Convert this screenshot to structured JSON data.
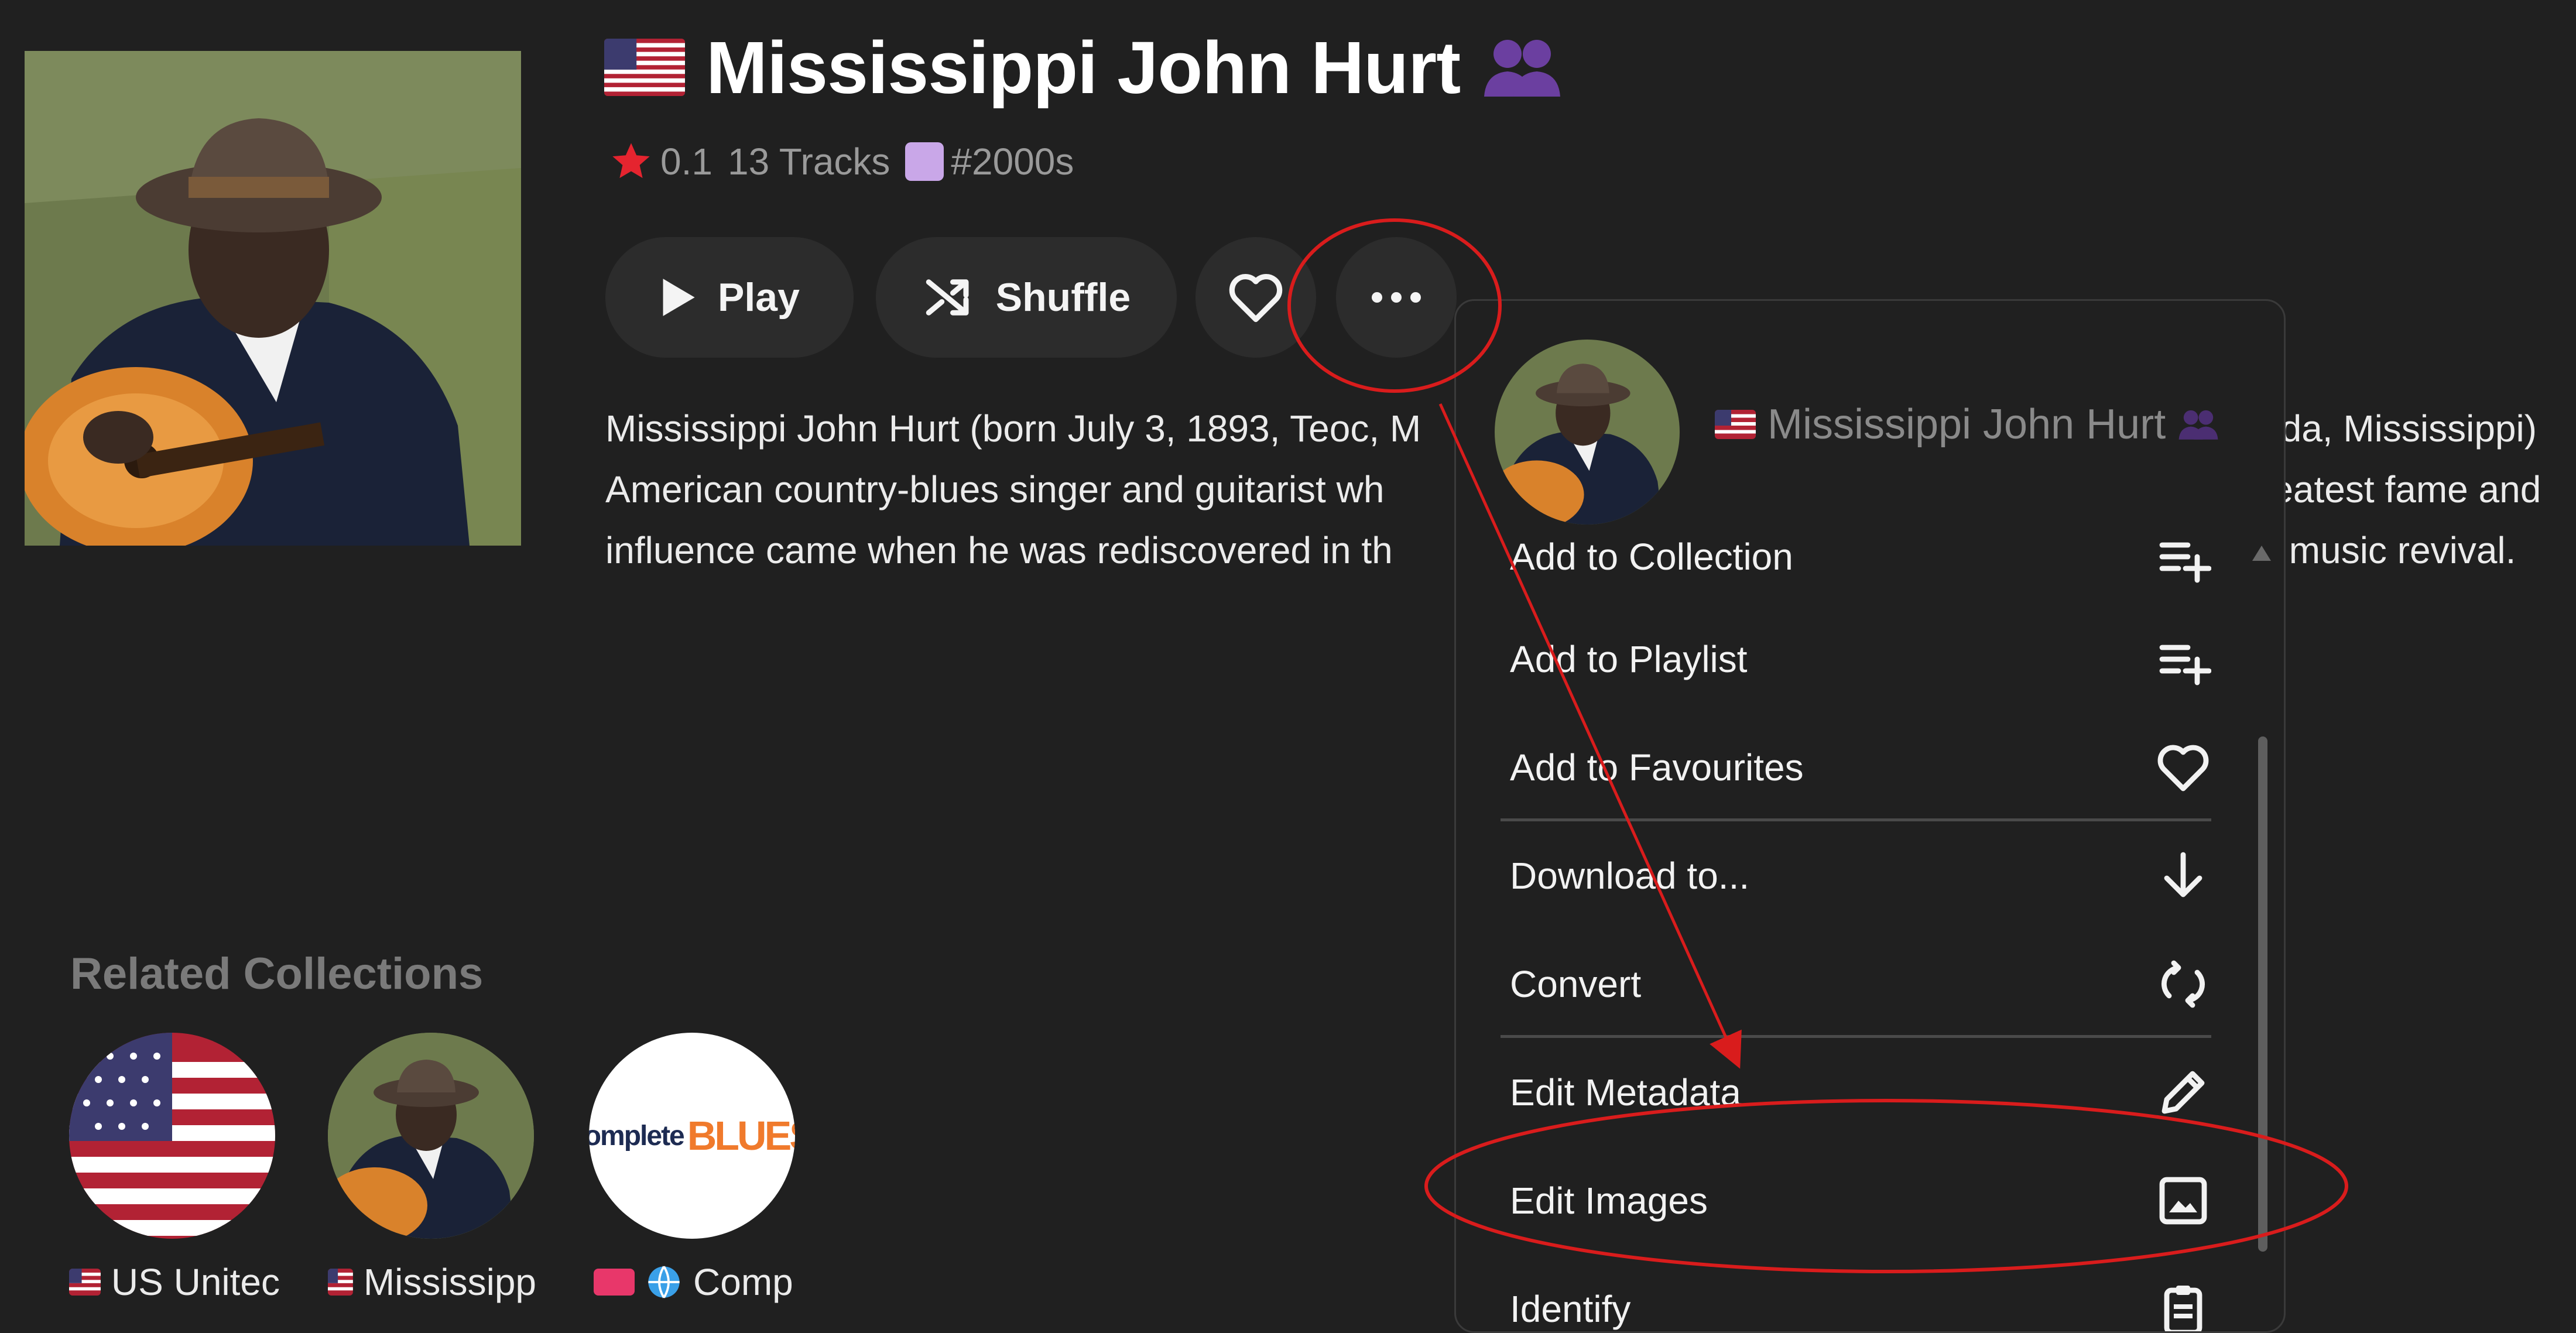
{
  "artist": {
    "name": "Mississippi John Hurt",
    "flag": "us-flag",
    "type_icon": "group-icon",
    "rating": "0.1",
    "tracks": "13 Tracks",
    "tag": "#2000s"
  },
  "actions": {
    "play": "Play",
    "shuffle": "Shuffle"
  },
  "bio": {
    "lines": [
      "Mississippi John Hurt (born July 3, 1893, Teoc, M",
      "American country-blues singer and guitarist wh",
      "influence came when he was rediscovered in th"
    ],
    "lines_right": [
      "ada, Mississippi)",
      "reatest fame and",
      "k music revival."
    ]
  },
  "related": {
    "heading": "Related Collections",
    "items": [
      {
        "label": "US Unitec",
        "thumb": "us-flag"
      },
      {
        "label": "Mississipp",
        "thumb": "artist-photo"
      },
      {
        "label": "Comp",
        "thumb": "complete-blues-logo",
        "logo_text": "complete",
        "logo_text2": "BLUES"
      }
    ]
  },
  "menu": {
    "header_name": "Mississippi John Hurt",
    "items": [
      {
        "label": "Add to Collection",
        "icon": "playlist-add-icon"
      },
      {
        "label": "Add to Playlist",
        "icon": "playlist-add-icon"
      },
      {
        "label": "Add to Favourites",
        "icon": "heart-icon"
      },
      {
        "label": "Download to...",
        "icon": "arrow-down-icon"
      },
      {
        "label": "Convert",
        "icon": "convert-icon"
      },
      {
        "label": "Edit Metadata",
        "icon": "pencil-icon"
      },
      {
        "label": "Edit Images",
        "icon": "image-icon"
      },
      {
        "label": "Identify",
        "icon": "clipboard-icon"
      }
    ]
  },
  "colors": {
    "background": "#202020",
    "pill": "#2c2c2c",
    "star": "#e5242f",
    "annotation": "#d91c1c",
    "tag_square": "#c9a7e8",
    "group_icon": "#6b3fa0"
  }
}
